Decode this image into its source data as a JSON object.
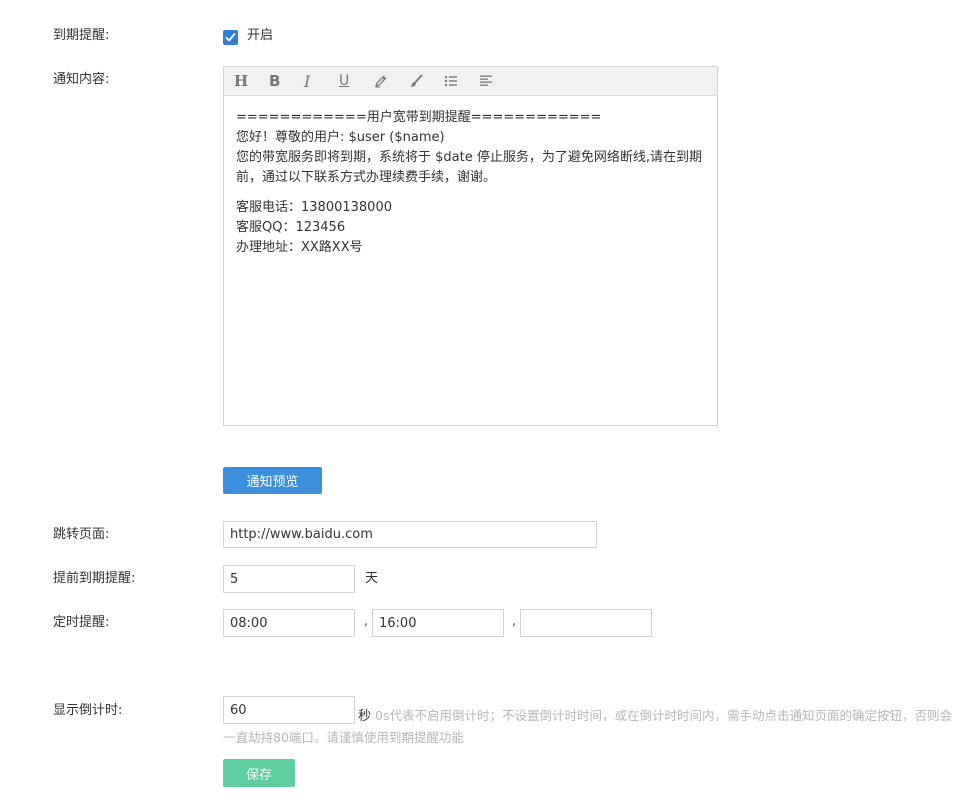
{
  "expiry_reminder": {
    "label": "到期提醒:",
    "checkbox_text": "开启",
    "checked": true
  },
  "notice_content": {
    "label": "通知内容:",
    "toolbar": [
      {
        "name": "heading",
        "glyph": "H"
      },
      {
        "name": "bold",
        "glyph": "B"
      },
      {
        "name": "italic",
        "glyph": "I"
      },
      {
        "name": "underline",
        "glyph": "U"
      },
      {
        "name": "highlighter",
        "glyph": "pen-icon"
      },
      {
        "name": "brush",
        "glyph": "brush-icon"
      },
      {
        "name": "unordered-list",
        "glyph": "list-icon"
      },
      {
        "name": "align-left",
        "glyph": "align-left-icon"
      }
    ],
    "lines": [
      "============用户宽带到期提醒============",
      "您好！尊敬的用户: $user ($name)",
      "您的带宽服务即将到期，系统将于 $date 停止服务，为了避免网络断线,请在到期前，通过以下联系方式办理续费手续，谢谢。",
      "客服电话：13800138000",
      "客服QQ：123456",
      "办理地址：XX路XX号"
    ]
  },
  "preview_button": "通知预览",
  "redirect_page": {
    "label": "跳转页面:",
    "value": "http://www.baidu.com"
  },
  "advance_reminder": {
    "label": "提前到期提醒:",
    "value": "5",
    "unit": "天"
  },
  "timed_reminder": {
    "label": "定时提醒:",
    "values": [
      "08:00",
      "16:00",
      ""
    ],
    "separator": ","
  },
  "countdown": {
    "label": "显示倒计时:",
    "value": "60",
    "unit": "秒",
    "hint": "0s代表不启用倒计时；不设置倒计时时间，或在倒计时时间内，需手动点击通知页面的确定按钮，否则会一直劫持80端口。请谨慎使用到期提醒功能"
  },
  "save_button": "保存",
  "colors": {
    "primary": "#3b8fdd",
    "success": "#5fcea0",
    "checkbox": "#2f7fd8",
    "hint": "#b8b8b8"
  }
}
